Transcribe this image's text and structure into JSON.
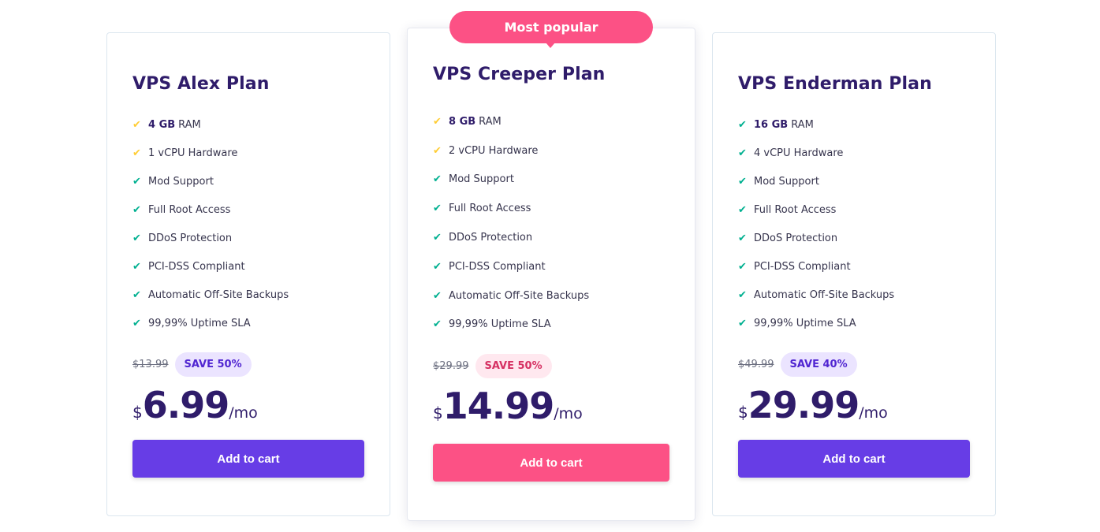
{
  "colors": {
    "navy": "#2f1c6a",
    "purple": "#673de6",
    "pink": "#fc5185",
    "check_green": "#00b090",
    "check_yellow": "#ffcd35",
    "save_purple_bg": "#ebe4ff",
    "save_pink_bg": "#ffe8ef"
  },
  "popular_badge": "Most popular",
  "plans": [
    {
      "name": "VPS Alex Plan",
      "features": [
        {
          "bold": "4 GB",
          "text": "RAM",
          "icon": "check-yellow"
        },
        {
          "bold": "",
          "text": "1 vCPU Hardware",
          "icon": "check-yellow"
        },
        {
          "bold": "",
          "text": "Mod Support",
          "icon": "check-green"
        },
        {
          "bold": "",
          "text": "Full Root Access",
          "icon": "check-green"
        },
        {
          "bold": "",
          "text": "DDoS Protection",
          "icon": "check-green"
        },
        {
          "bold": "",
          "text": "PCI-DSS Compliant",
          "icon": "check-green"
        },
        {
          "bold": "",
          "text": "Automatic Off-Site Backups",
          "icon": "check-green"
        },
        {
          "bold": "",
          "text": "99,99% Uptime SLA",
          "icon": "check-green"
        }
      ],
      "old_price": "$13.99",
      "save": "SAVE 50%",
      "currency": "$",
      "price": "6.99",
      "period": "/mo",
      "cta": "Add to cart"
    },
    {
      "name": "VPS Creeper Plan",
      "features": [
        {
          "bold": "8 GB",
          "text": "RAM",
          "icon": "check-yellow"
        },
        {
          "bold": "",
          "text": "2 vCPU Hardware",
          "icon": "check-yellow"
        },
        {
          "bold": "",
          "text": "Mod Support",
          "icon": "check-green"
        },
        {
          "bold": "",
          "text": "Full Root Access",
          "icon": "check-green"
        },
        {
          "bold": "",
          "text": "DDoS Protection",
          "icon": "check-green"
        },
        {
          "bold": "",
          "text": "PCI-DSS Compliant",
          "icon": "check-green"
        },
        {
          "bold": "",
          "text": "Automatic Off-Site Backups",
          "icon": "check-green"
        },
        {
          "bold": "",
          "text": "99,99% Uptime SLA",
          "icon": "check-green"
        }
      ],
      "old_price": "$29.99",
      "save": "SAVE 50%",
      "currency": "$",
      "price": "14.99",
      "period": "/mo",
      "cta": "Add to cart"
    },
    {
      "name": "VPS Enderman Plan",
      "features": [
        {
          "bold": "16 GB",
          "text": "RAM",
          "icon": "check-green"
        },
        {
          "bold": "",
          "text": "4 vCPU Hardware",
          "icon": "check-green"
        },
        {
          "bold": "",
          "text": "Mod Support",
          "icon": "check-green"
        },
        {
          "bold": "",
          "text": "Full Root Access",
          "icon": "check-green"
        },
        {
          "bold": "",
          "text": "DDoS Protection",
          "icon": "check-green"
        },
        {
          "bold": "",
          "text": "PCI-DSS Compliant",
          "icon": "check-green"
        },
        {
          "bold": "",
          "text": "Automatic Off-Site Backups",
          "icon": "check-green"
        },
        {
          "bold": "",
          "text": "99,99% Uptime SLA",
          "icon": "check-green"
        }
      ],
      "old_price": "$49.99",
      "save": "SAVE 40%",
      "currency": "$",
      "price": "29.99",
      "period": "/mo",
      "cta": "Add to cart"
    }
  ]
}
